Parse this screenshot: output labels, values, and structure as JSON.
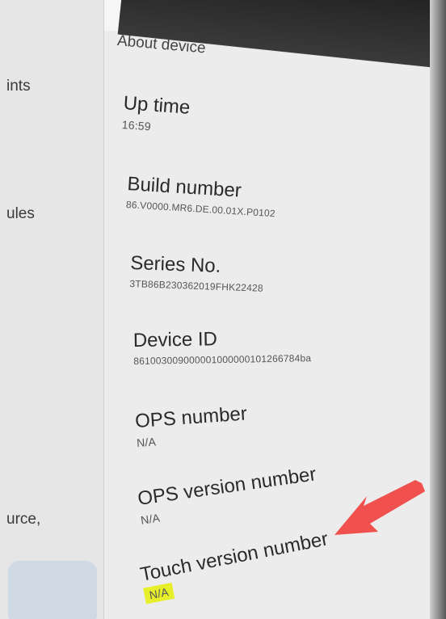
{
  "sidebar": {
    "items": [
      {
        "label": "ints"
      },
      {
        "label": "ules"
      },
      {
        "label": "urce,"
      }
    ]
  },
  "header": {
    "title": "About device"
  },
  "rows": [
    {
      "label": "Up time",
      "value": "16:59"
    },
    {
      "label": "Build number",
      "value": "86.V0000.MR6.DE.00.01X.P0102"
    },
    {
      "label": "Series No.",
      "value": "3TB86B230362019FHK22428"
    },
    {
      "label": "Device ID",
      "value": "861003009000001000000101266784ba"
    },
    {
      "label": "OPS number",
      "value": "N/A"
    },
    {
      "label": "OPS version number",
      "value": "N/A"
    },
    {
      "label": "Touch version number",
      "value": "N/A"
    }
  ],
  "colors": {
    "highlight": "#e6ef2a",
    "arrow": "#f0504e"
  }
}
